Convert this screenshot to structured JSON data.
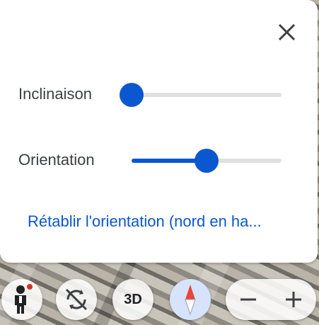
{
  "panel": {
    "close_icon": "close-icon",
    "tilt": {
      "label": "Inclinaison",
      "value": 0.0
    },
    "orientation": {
      "label": "Orientation",
      "value": 0.5
    },
    "reset_link": "Rétablir l'orientation (nord en ha..."
  },
  "controls": {
    "pegman_icon": "pegman-icon",
    "rotate_icon": "rotate-icon",
    "btn_3d_label": "3D",
    "compass_icon": "compass-icon",
    "zoom_out_icon": "minus-icon",
    "zoom_in_icon": "plus-icon"
  },
  "colors": {
    "accent": "#0b57d0",
    "track": "#e0e0e0",
    "compass_red": "#e8453c",
    "pegman_dot": "#d93025"
  }
}
